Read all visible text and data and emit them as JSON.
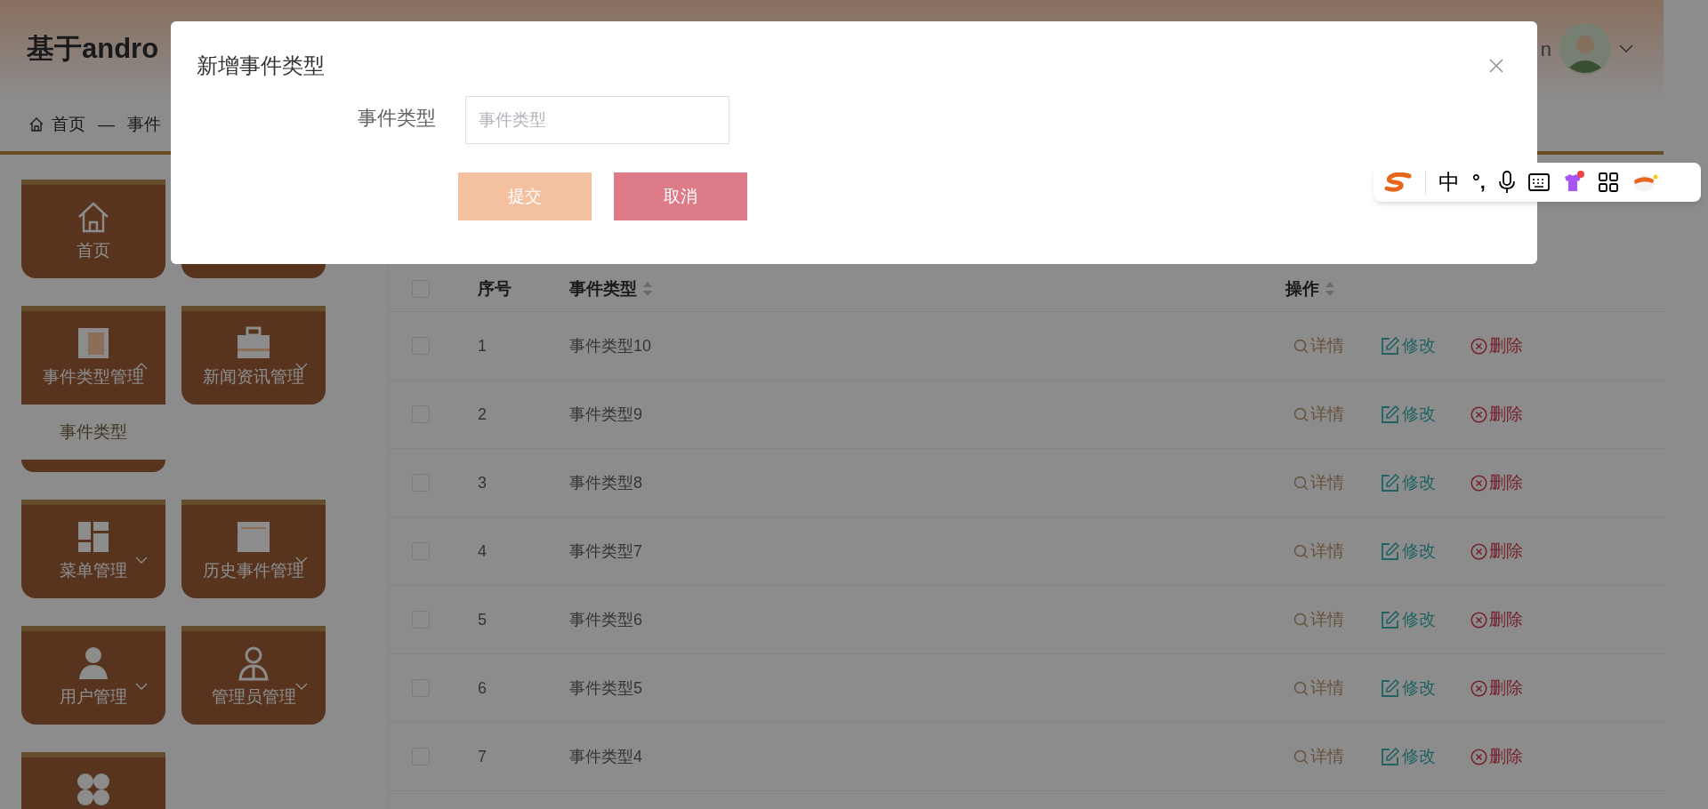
{
  "header": {
    "title": "基于andro",
    "user": "n"
  },
  "breadcrumb": {
    "home": "首页",
    "separator": "—",
    "current": "事件"
  },
  "sidebar": {
    "items": [
      {
        "kind": "link",
        "label": "首页"
      },
      {
        "kind": "covered"
      },
      {
        "kind": "menu",
        "label": "事件类型管理",
        "expanded": true,
        "children": [
          {
            "label": "事件类型"
          }
        ]
      },
      {
        "kind": "menu",
        "label": "新闻资讯管理",
        "expanded": false
      },
      {
        "kind": "menu",
        "label": "菜单管理",
        "expanded": false
      },
      {
        "kind": "menu",
        "label": "历史事件管理",
        "expanded": false
      },
      {
        "kind": "menu",
        "label": "用户管理",
        "expanded": false
      },
      {
        "kind": "menu",
        "label": "管理员管理",
        "expanded": false
      },
      {
        "kind": "menu"
      }
    ]
  },
  "table": {
    "header_checked": false,
    "columns": [
      {
        "label": "序号",
        "sortable": false
      },
      {
        "label": "事件类型",
        "sortable": true
      },
      {
        "label": "操作",
        "sortable": true
      }
    ],
    "rows": [
      {
        "checked": false,
        "index": "1",
        "name": "事件类型10",
        "actions": [
          "详情",
          "修改",
          "删除"
        ]
      },
      {
        "checked": false,
        "index": "2",
        "name": "事件类型9",
        "actions": [
          "详情",
          "修改",
          "删除"
        ]
      },
      {
        "checked": false,
        "index": "3",
        "name": "事件类型8",
        "actions": [
          "详情",
          "修改",
          "删除"
        ]
      },
      {
        "checked": false,
        "index": "4",
        "name": "事件类型7",
        "actions": [
          "详情",
          "修改",
          "删除"
        ]
      },
      {
        "checked": false,
        "index": "5",
        "name": "事件类型6",
        "actions": [
          "详情",
          "修改",
          "删除"
        ]
      },
      {
        "checked": false,
        "index": "6",
        "name": "事件类型5",
        "actions": [
          "详情",
          "修改",
          "删除"
        ]
      },
      {
        "checked": false,
        "index": "7",
        "name": "事件类型4",
        "actions": [
          "详情",
          "修改",
          "删除"
        ]
      }
    ]
  },
  "dialog": {
    "title": "新增事件类型",
    "field": {
      "label": "事件类型",
      "placeholder": "事件类型"
    },
    "buttons": [
      {
        "kind": "submit",
        "label": "提交"
      },
      {
        "kind": "cancel",
        "label": "取消"
      }
    ]
  },
  "ime_toolbar": {
    "mode": "中",
    "punctuation": "°,"
  }
}
